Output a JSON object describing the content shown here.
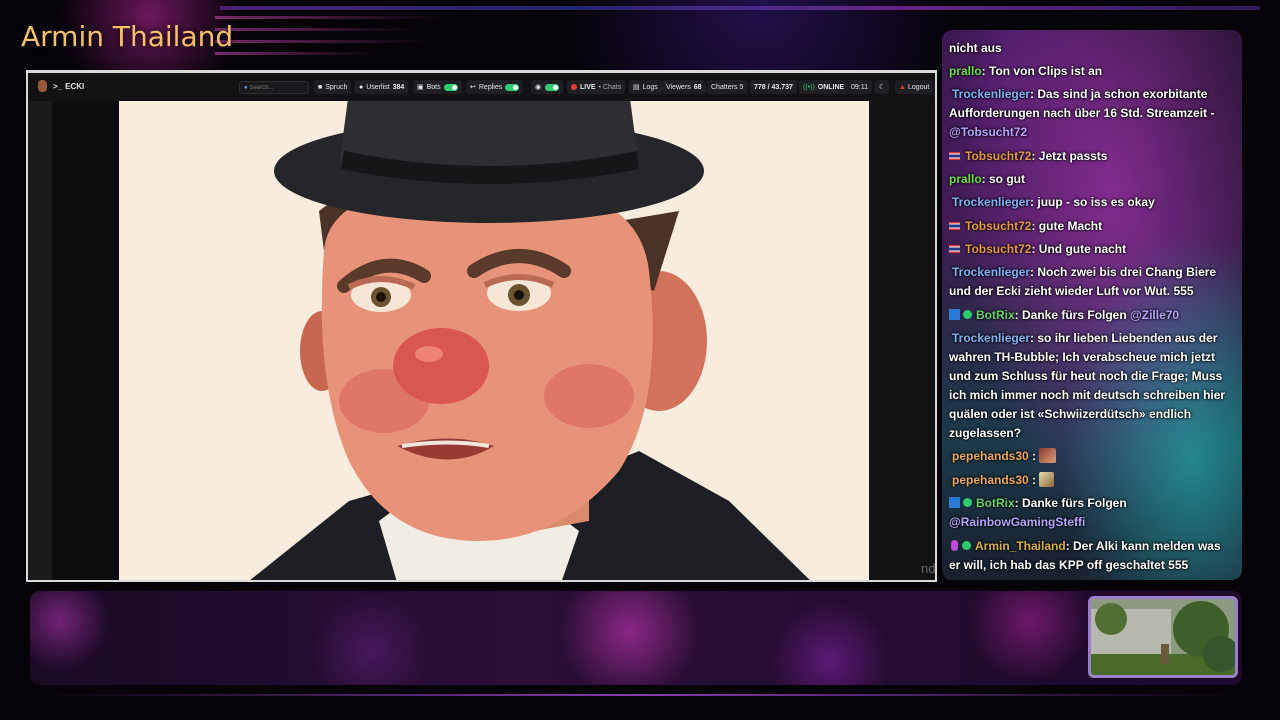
{
  "channel": {
    "title": "Armin Thailand"
  },
  "dashboard": {
    "brand": "ECKI",
    "search_placeholder": "Search...",
    "buttons": {
      "spruch": "Spruch",
      "userlist_label": "Userlist",
      "userlist_count": "384",
      "bots": "Bots",
      "replies": "Replies",
      "live": "LIVE",
      "chats": "• Chats",
      "logs": "Logs",
      "viewers_label": "Viewers",
      "viewers_count": "68",
      "chatters_label": "Chatters 5",
      "ratio": "778 / 43.737",
      "online": "ONLINE",
      "time": "09:11",
      "logout": "Logout"
    },
    "gutter_text": "nd"
  },
  "chat": {
    "m0": {
      "text": "nicht aus"
    },
    "m1": {
      "user": "prallo",
      "text": ": Ton von Clips ist an"
    },
    "m2": {
      "user": "Trockenlieger",
      "text": ": Das sind ja schon exorbitante Aufforderungen nach über 16 Std. Streamzeit - ",
      "mention": "@Tobsucht72"
    },
    "m3": {
      "user": "Tobsucht72",
      "text": ": Jetzt passts"
    },
    "m4": {
      "user": "prallo",
      "text": ": so gut"
    },
    "m5": {
      "user": "Trockenlieger",
      "text": ": juup - so iss es okay"
    },
    "m6": {
      "user": "Tobsucht72",
      "text": ": gute Macht"
    },
    "m7": {
      "user": "Tobsucht72",
      "text": ": Und gute nacht"
    },
    "m8": {
      "user": "Trockenlieger",
      "text": ": Noch zwei bis drei Chang Biere und der Ecki zieht wieder Luft vor Wut. 555"
    },
    "m9": {
      "user": "BotRix",
      "text": ": Danke fürs Folgen ",
      "mention": "@Zille70"
    },
    "m10": {
      "user": "Trockenlieger",
      "text": ": so ihr lieben Liebenden aus der wahren TH-Bubble; Ich verabscheue mich jetzt und zum Schluss für heut noch die Frage; Muss ich mich immer noch mit deutsch schreiben hier quälen oder ist «Schwiizerdütsch» endlich zugelassen?"
    },
    "m11": {
      "user": "pepehands30",
      "text": " :"
    },
    "m12": {
      "user": "pepehands30",
      "text": " :"
    },
    "m13": {
      "user": "BotRix",
      "text": ": Danke fürs Folgen ",
      "mention": "@RainbowGamingSteffi"
    },
    "m14": {
      "user": "Armin_Thailand",
      "text": ": Der Alki kann melden was er will, ich hab das KPP off geschaltet 555"
    }
  },
  "colors": {
    "title": "#f5c16a",
    "name_prallo": "#6ee04a",
    "name_trockenlieger": "#7fb4f5",
    "name_tobsucht": "#e59a4a",
    "name_botrix": "#63d36a",
    "mention": "#b9a4ff",
    "toggle_on": "#2ecc71",
    "live": "#e53935"
  },
  "icons": [
    "terminal-icon",
    "search-icon",
    "spruch-icon",
    "user-icon",
    "bot-icon",
    "reply-icon",
    "live-dot-icon",
    "logs-icon",
    "online-icon",
    "moon-icon",
    "logout-icon",
    "thai-flag-icon",
    "bot-badge-icon",
    "verified-badge-icon",
    "mic-badge-icon",
    "emote-icon"
  ]
}
